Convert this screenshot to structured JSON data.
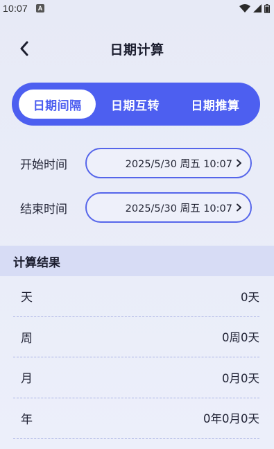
{
  "status_bar": {
    "time": "10:07",
    "notification_badge": "A",
    "icons": [
      "wifi-icon",
      "signal-icon",
      "battery-icon"
    ]
  },
  "header": {
    "title": "日期计算",
    "back_icon": "chevron-left-icon"
  },
  "tabs": [
    {
      "label": "日期间隔",
      "active": true
    },
    {
      "label": "日期互转",
      "active": false
    },
    {
      "label": "日期推算",
      "active": false
    }
  ],
  "start": {
    "label": "开始时间",
    "value": "2025/5/30 周五 10:07"
  },
  "end": {
    "label": "结束时间",
    "value": "2025/5/30 周五 10:07"
  },
  "results": {
    "title": "计算结果",
    "rows": [
      {
        "label": "天",
        "value": "0天"
      },
      {
        "label": "周",
        "value": "0周0天"
      },
      {
        "label": "月",
        "value": "0月0天"
      },
      {
        "label": "年",
        "value": "0年0月0天"
      }
    ]
  },
  "colors": {
    "accent": "#4d5ff0",
    "field_border": "#5565ea",
    "section_bg": "#d7dcf5"
  }
}
